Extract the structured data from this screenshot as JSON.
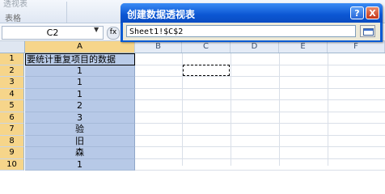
{
  "ribbon": {
    "partial_label": "透视表",
    "group_label": "表格"
  },
  "formula_bar": {
    "name_box": "C2",
    "fx": "fx"
  },
  "columns": [
    "A",
    "B",
    "C",
    "D",
    "E",
    "F"
  ],
  "rows": [
    {
      "num": "1",
      "value": "要统计重复项目的数据"
    },
    {
      "num": "2",
      "value": "1"
    },
    {
      "num": "3",
      "value": "1"
    },
    {
      "num": "4",
      "value": "1"
    },
    {
      "num": "5",
      "value": "2"
    },
    {
      "num": "6",
      "value": "3"
    },
    {
      "num": "7",
      "value": "验"
    },
    {
      "num": "8",
      "value": "旧"
    },
    {
      "num": "9",
      "value": "森"
    },
    {
      "num": "10",
      "value": "1"
    }
  ],
  "dialog": {
    "title": "创建数据透视表",
    "help_label": "?",
    "close_label": "X",
    "reference": "Sheet1!$C$2"
  }
}
